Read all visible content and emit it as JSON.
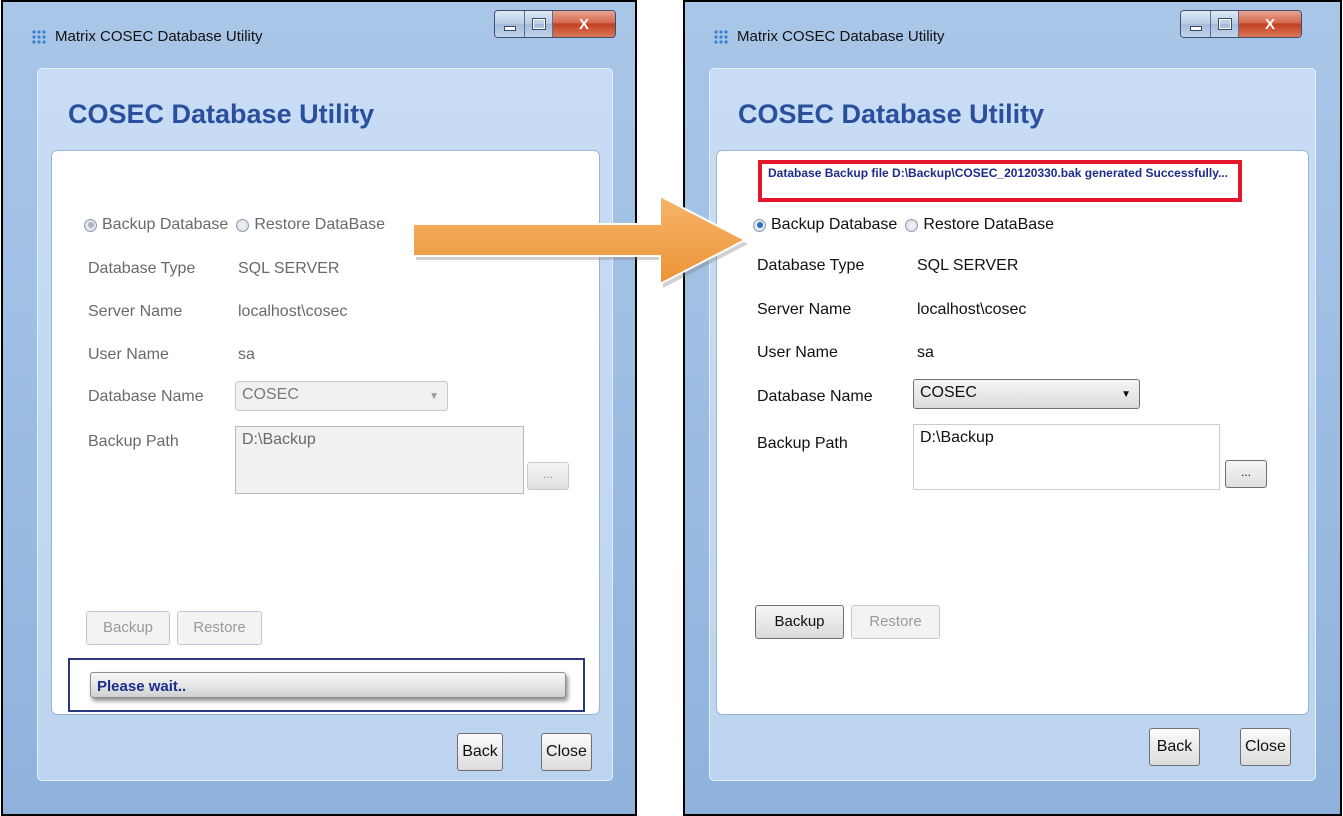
{
  "app": {
    "window_title": "Matrix COSEC Database Utility",
    "heading": "COSEC Database Utility"
  },
  "left_window": {
    "state": "in-progress",
    "radios": {
      "backup_label": "Backup Database",
      "restore_label": "Restore DataBase",
      "selected": "backup"
    },
    "fields": {
      "db_type_label": "Database Type",
      "db_type_value": "SQL SERVER",
      "server_label": "Server Name",
      "server_value": "localhost\\cosec",
      "user_label": "User Name",
      "user_value": "sa",
      "dbname_label": "Database Name",
      "dbname_value": "COSEC",
      "path_label": "Backup Path",
      "path_value": "D:\\Backup",
      "browse_label": "..."
    },
    "buttons": {
      "backup": "Backup",
      "restore": "Restore",
      "back": "Back",
      "close": "Close"
    },
    "progress_text": "Please wait.."
  },
  "right_window": {
    "state": "completed",
    "status_message": "Database Backup file D:\\Backup\\COSEC_20120330.bak generated Successfully...",
    "radios": {
      "backup_label": "Backup Database",
      "restore_label": "Restore DataBase",
      "selected": "backup"
    },
    "fields": {
      "db_type_label": "Database Type",
      "db_type_value": "SQL SERVER",
      "server_label": "Server Name",
      "server_value": "localhost\\cosec",
      "user_label": "User Name",
      "user_value": "sa",
      "dbname_label": "Database Name",
      "dbname_value": "COSEC",
      "path_label": "Backup Path",
      "path_value": "D:\\Backup",
      "browse_label": "..."
    },
    "buttons": {
      "backup": "Backup",
      "restore": "Restore",
      "back": "Back",
      "close": "Close"
    }
  },
  "colors": {
    "heading": "#2a4f9c",
    "status_border": "#e3162a",
    "status_text": "#1d2d8a",
    "arrow": "#f0a048",
    "window_frame": "#9fbfe4"
  }
}
